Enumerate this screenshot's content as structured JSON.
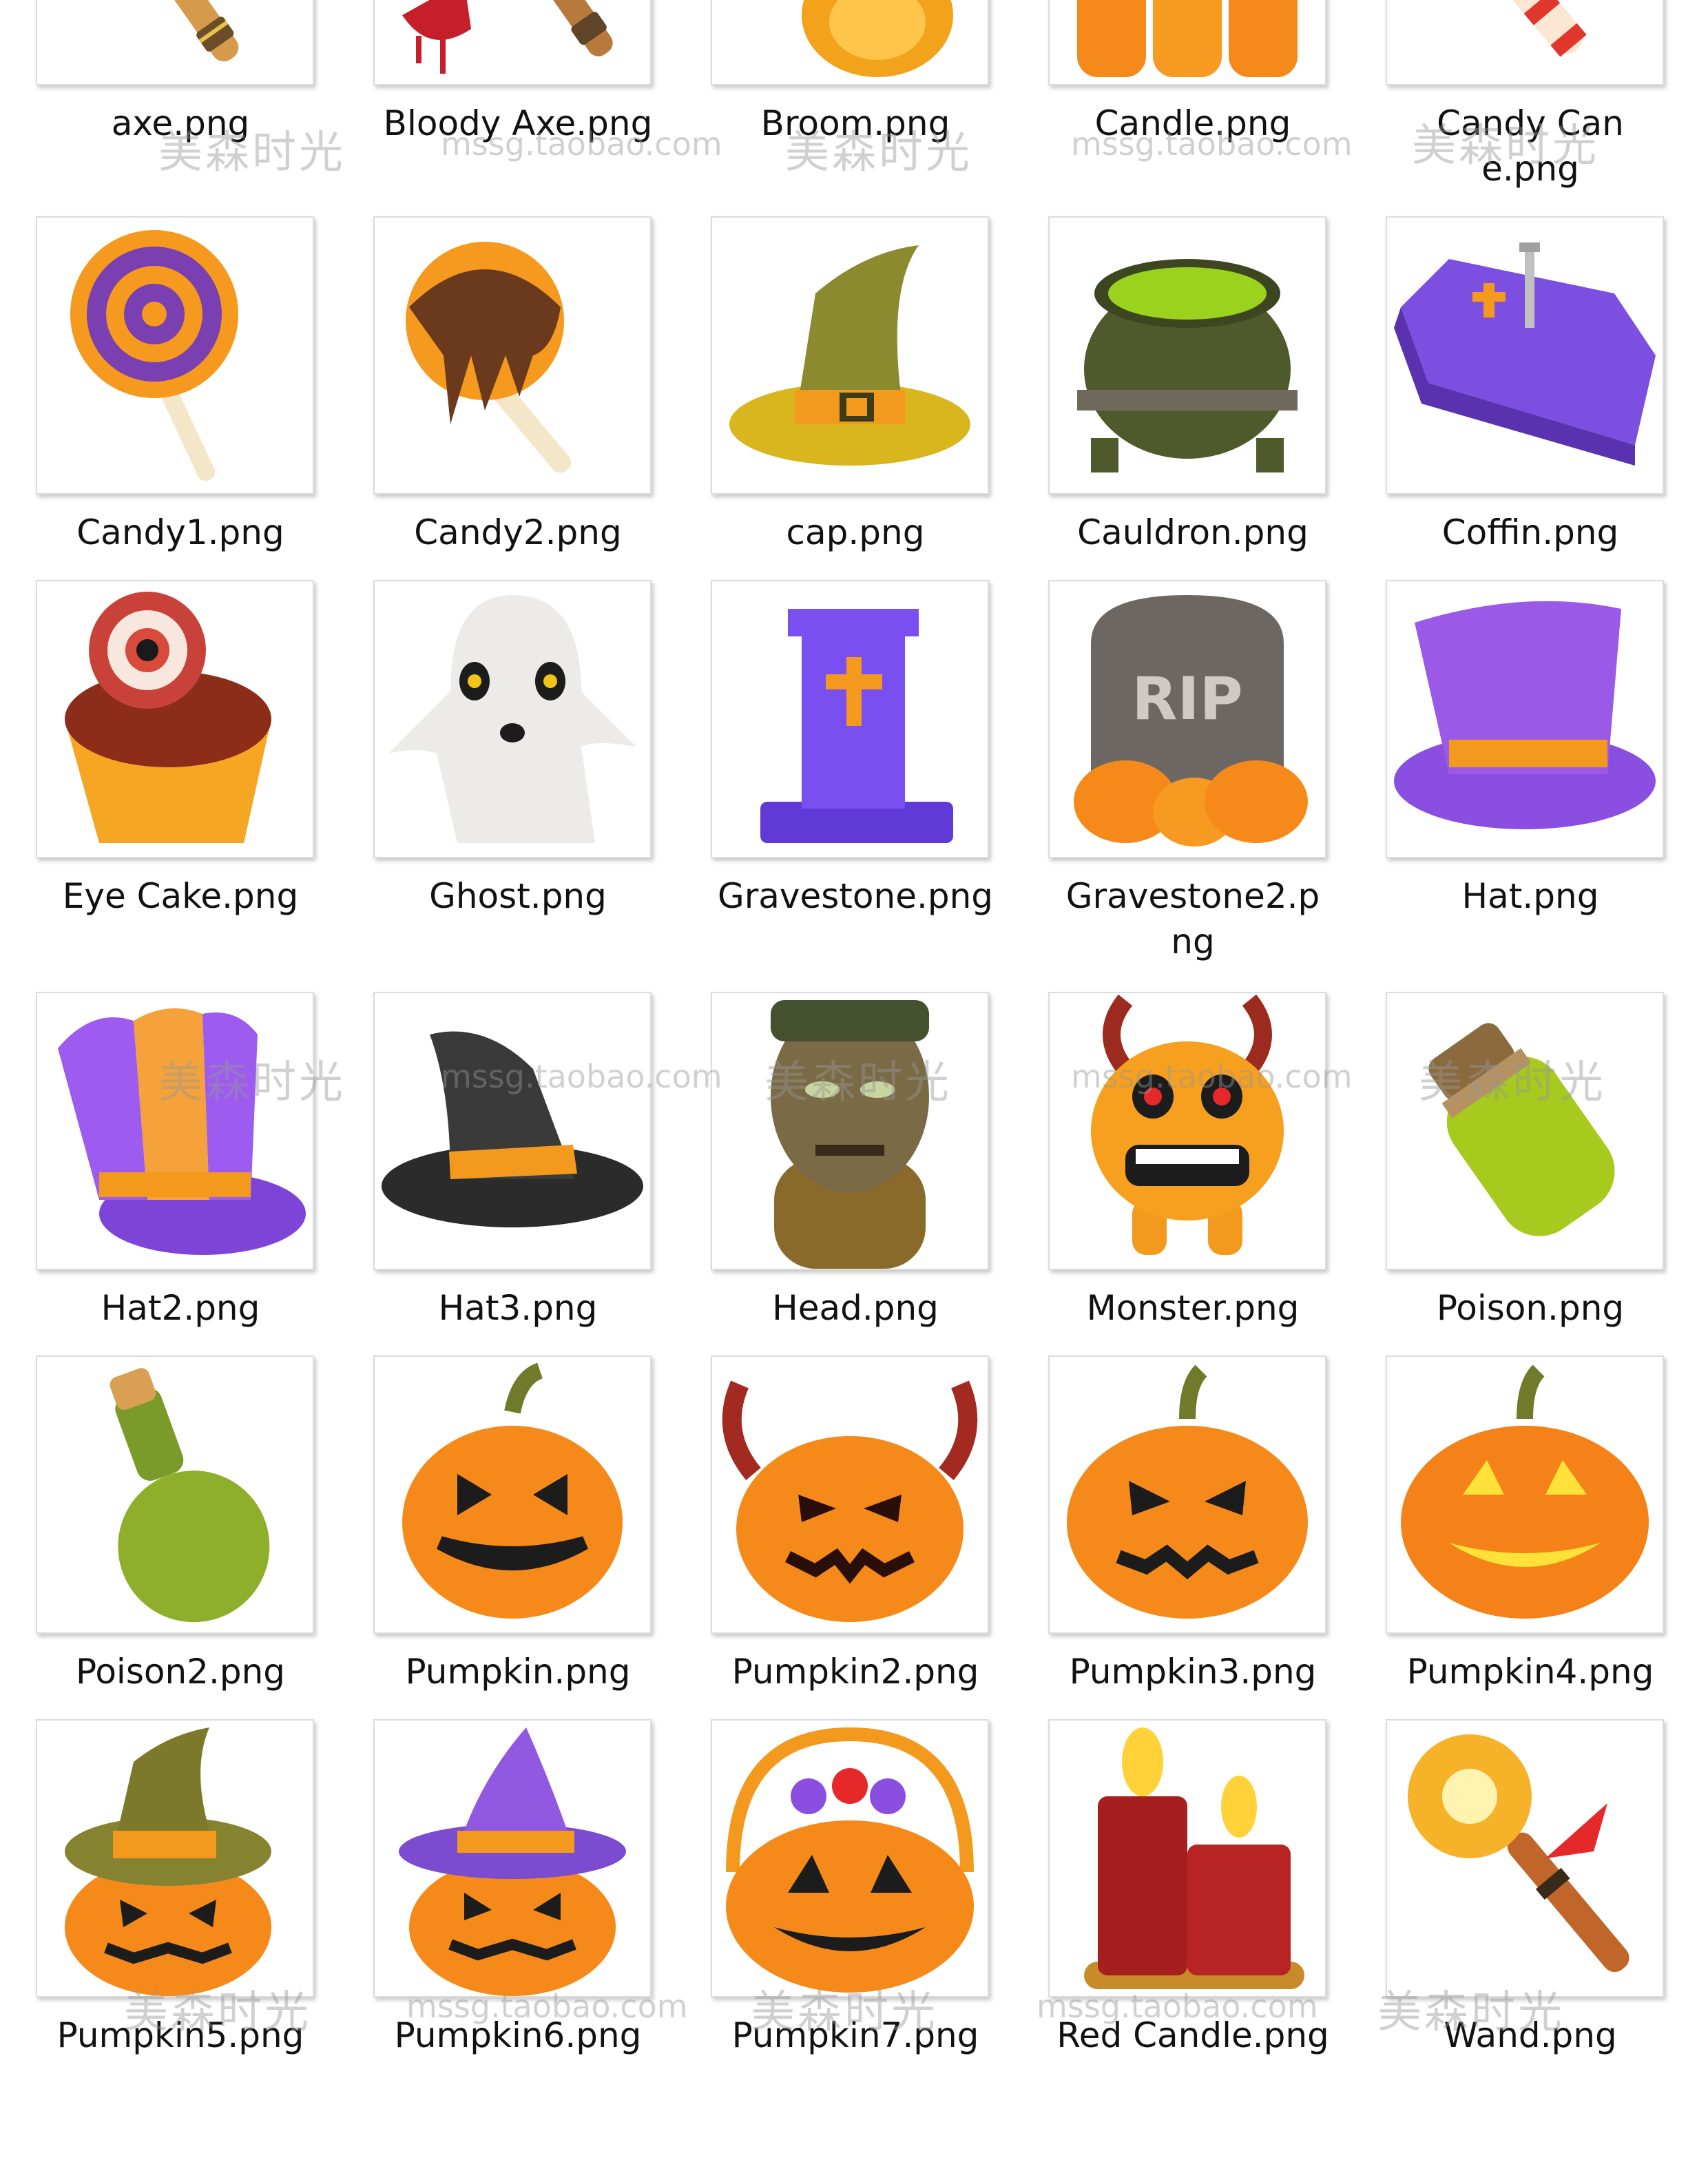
{
  "files": [
    {
      "label": "axe.png",
      "icon": "axe-icon"
    },
    {
      "label": "Bloody Axe.png",
      "icon": "bloody-axe-icon"
    },
    {
      "label": "Broom.png",
      "icon": "broom-icon"
    },
    {
      "label": "Candle.png",
      "icon": "candle-icon"
    },
    {
      "label": "Candy Cane.png",
      "icon": "candy-cane-icon"
    },
    {
      "label": "Candy1.png",
      "icon": "lollipop-icon"
    },
    {
      "label": "Candy2.png",
      "icon": "candy-apple-icon"
    },
    {
      "label": "cap.png",
      "icon": "witch-cap-icon"
    },
    {
      "label": "Cauldron.png",
      "icon": "cauldron-icon"
    },
    {
      "label": "Coffin.png",
      "icon": "coffin-icon"
    },
    {
      "label": "Eye Cake.png",
      "icon": "eye-cake-icon"
    },
    {
      "label": "Ghost.png",
      "icon": "ghost-icon"
    },
    {
      "label": "Gravestone.png",
      "icon": "gravestone-icon"
    },
    {
      "label": "Gravestone2.png",
      "icon": "rip-gravestone-icon"
    },
    {
      "label": "Hat.png",
      "icon": "top-hat-icon"
    },
    {
      "label": "Hat2.png",
      "icon": "striped-hat-icon"
    },
    {
      "label": "Hat3.png",
      "icon": "witch-hat-icon"
    },
    {
      "label": "Head.png",
      "icon": "monster-head-icon"
    },
    {
      "label": "Monster.png",
      "icon": "monster-icon"
    },
    {
      "label": "Poison.png",
      "icon": "poison-jar-icon"
    },
    {
      "label": "Poison2.png",
      "icon": "poison-bottle-icon"
    },
    {
      "label": "Pumpkin.png",
      "icon": "pumpkin-icon"
    },
    {
      "label": "Pumpkin2.png",
      "icon": "devil-pumpkin-icon"
    },
    {
      "label": "Pumpkin3.png",
      "icon": "pumpkin-icon"
    },
    {
      "label": "Pumpkin4.png",
      "icon": "glowing-pumpkin-icon"
    },
    {
      "label": "Pumpkin5.png",
      "icon": "pumpkin-witch-cap-icon"
    },
    {
      "label": "Pumpkin6.png",
      "icon": "pumpkin-witch-hat-icon"
    },
    {
      "label": "Pumpkin7.png",
      "icon": "pumpkin-basket-icon"
    },
    {
      "label": "Red Candle.png",
      "icon": "red-candle-icon"
    },
    {
      "label": "Wand.png",
      "icon": "wand-icon"
    }
  ],
  "watermarks": {
    "cn": "美森时光",
    "url": "mssg.taobao.com"
  }
}
